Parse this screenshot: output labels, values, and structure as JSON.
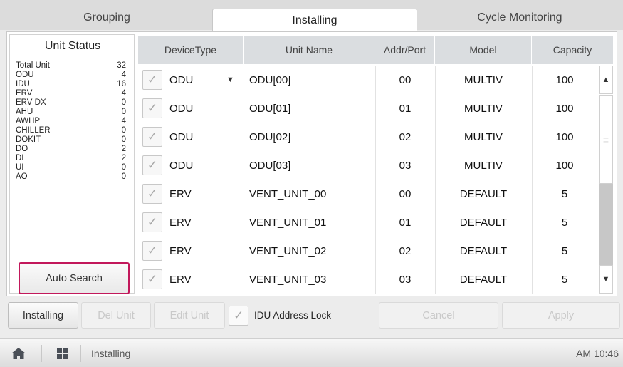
{
  "tabs": {
    "grouping": "Grouping",
    "installing": "Installing",
    "cycle_monitoring": "Cycle Monitoring"
  },
  "unit_status": {
    "title": "Unit Status",
    "rows": [
      {
        "label": "Total Unit",
        "value": "32"
      },
      {
        "label": "ODU",
        "value": "4"
      },
      {
        "label": "IDU",
        "value": "16"
      },
      {
        "label": "ERV",
        "value": "4"
      },
      {
        "label": "ERV DX",
        "value": "0"
      },
      {
        "label": "AHU",
        "value": "0"
      },
      {
        "label": "AWHP",
        "value": "4"
      },
      {
        "label": "CHILLER",
        "value": "0"
      },
      {
        "label": "DOKIT",
        "value": "0"
      },
      {
        "label": "DO",
        "value": "2"
      },
      {
        "label": "DI",
        "value": "2"
      },
      {
        "label": "UI",
        "value": "0"
      },
      {
        "label": "AO",
        "value": "0"
      }
    ],
    "auto_search": "Auto Search"
  },
  "table": {
    "headers": {
      "device_type": "DeviceType",
      "unit_name": "Unit Name",
      "addr_port": "Addr/Port",
      "model": "Model",
      "capacity": "Capacity"
    },
    "rows": [
      {
        "device_type": "ODU",
        "unit_name": "ODU[00]",
        "addr_port": "00",
        "model": "MULTIV",
        "capacity": "100"
      },
      {
        "device_type": "ODU",
        "unit_name": "ODU[01]",
        "addr_port": "01",
        "model": "MULTIV",
        "capacity": "100"
      },
      {
        "device_type": "ODU",
        "unit_name": "ODU[02]",
        "addr_port": "02",
        "model": "MULTIV",
        "capacity": "100"
      },
      {
        "device_type": "ODU",
        "unit_name": "ODU[03]",
        "addr_port": "03",
        "model": "MULTIV",
        "capacity": "100"
      },
      {
        "device_type": "ERV",
        "unit_name": "VENT_UNIT_00",
        "addr_port": "00",
        "model": "DEFAULT",
        "capacity": "5"
      },
      {
        "device_type": "ERV",
        "unit_name": "VENT_UNIT_01",
        "addr_port": "01",
        "model": "DEFAULT",
        "capacity": "5"
      },
      {
        "device_type": "ERV",
        "unit_name": "VENT_UNIT_02",
        "addr_port": "02",
        "model": "DEFAULT",
        "capacity": "5"
      },
      {
        "device_type": "ERV",
        "unit_name": "VENT_UNIT_03",
        "addr_port": "03",
        "model": "DEFAULT",
        "capacity": "5"
      }
    ]
  },
  "actions": {
    "installing": "Installing",
    "del_unit": "Del Unit",
    "edit_unit": "Edit Unit",
    "idu_address_lock": "IDU Address Lock",
    "cancel": "Cancel",
    "apply": "Apply"
  },
  "footer": {
    "title": "Installing",
    "time": "AM 10:46"
  },
  "icons": {
    "check": "check-icon",
    "dropdown": "caret-down-icon",
    "home": "home-icon",
    "grid": "grid-menu-icon"
  },
  "colors": {
    "highlight": "#c2185b",
    "header_bg": "#dadde0"
  }
}
